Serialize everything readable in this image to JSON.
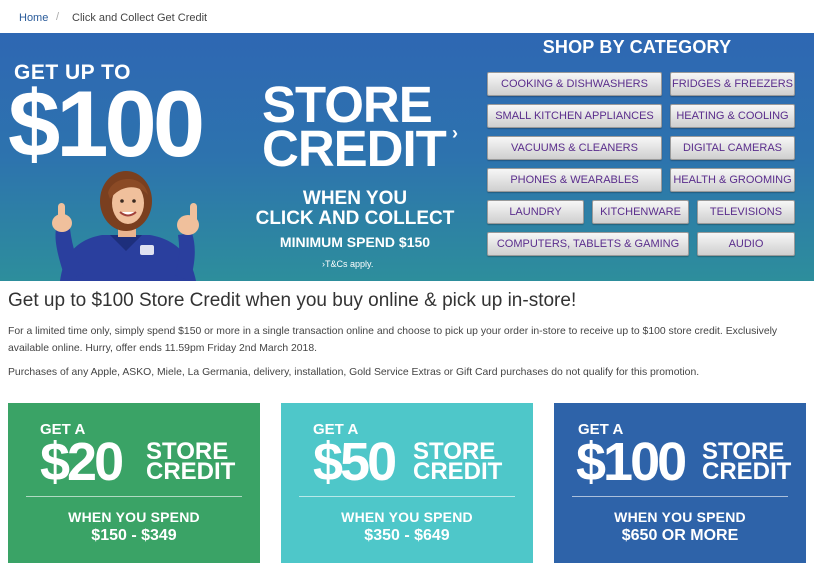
{
  "breadcrumb": {
    "home": "Home",
    "separator": "/",
    "current": "Click and Collect Get Credit"
  },
  "hero": {
    "get_up_to": "GET UP TO",
    "amount": "$100",
    "store": "STORE",
    "credit": "CREDIT",
    "chevron": "›",
    "when_line1": "WHEN YOU",
    "when_line2": "CLICK AND COLLECT",
    "minimum": "MINIMUM SPEND $150",
    "tcs": "›T&Cs apply.",
    "colors": {
      "top": "#2e67b3",
      "bottom": "#2d8e9c"
    }
  },
  "shop": {
    "title": "SHOP BY CATEGORY",
    "categories": [
      "COOKING & DISHWASHERS",
      "FRIDGES & FREEZERS",
      "SMALL KITCHEN APPLIANCES",
      "HEATING & COOLING",
      "VACUUMS & CLEANERS",
      "DIGITAL CAMERAS",
      "PHONES & WEARABLES",
      "HEALTH & GROOMING",
      "LAUNDRY",
      "KITCHENWARE",
      "TELEVISIONS",
      "COMPUTERS, TABLETS & GAMING",
      "AUDIO"
    ]
  },
  "main": {
    "headline": "Get up to $100 Store Credit when you buy online & pick up in-store!",
    "para1": "For a limited time only, simply spend $150 or more in a single transaction online and choose to pick up your order in-store to receive up to $100 store credit. Exclusively available online. Hurry, offer ends 11.59pm Friday 2nd March 2018.",
    "para2": "Purchases of any Apple, ASKO, Miele, La Germania, delivery, installation, Gold Service Extras or Gift Card purchases do not qualify for this promotion."
  },
  "tiles": [
    {
      "get": "GET A",
      "amount": "$20",
      "store": "STORE",
      "credit": "CREDIT",
      "chevron": "›",
      "when": "WHEN YOU SPEND",
      "range": "$150 - $349",
      "color": "#3aa366"
    },
    {
      "get": "GET A",
      "amount": "$50",
      "store": "STORE",
      "credit": "CREDIT",
      "chevron": "›",
      "when": "WHEN YOU SPEND",
      "range": "$350 - $649",
      "color": "#4ec7c9"
    },
    {
      "get": "GET A",
      "amount": "$100",
      "store": "STORE",
      "credit": "CREDIT",
      "chevron": "›",
      "when": "WHEN YOU SPEND",
      "range": "$650 OR MORE",
      "color": "#2e63a9"
    }
  ]
}
